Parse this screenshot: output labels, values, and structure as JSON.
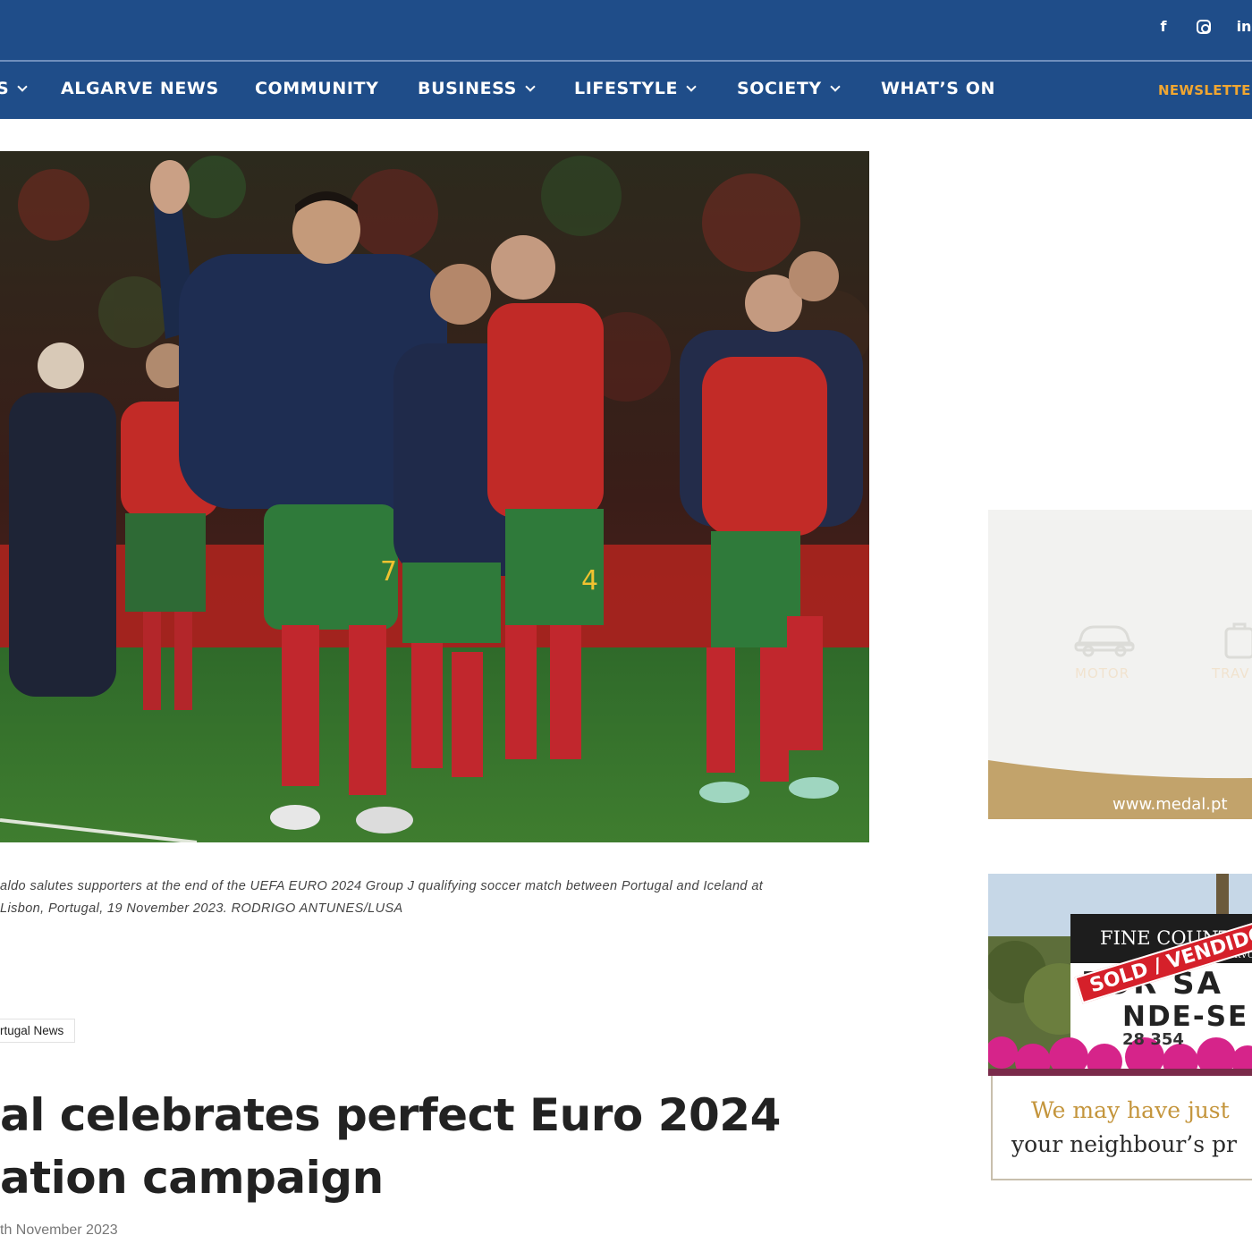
{
  "header": {
    "social": [
      {
        "icon": "facebook-icon",
        "glyph": "f"
      },
      {
        "icon": "instagram-icon",
        "glyph": ""
      },
      {
        "icon": "linkedin-icon",
        "glyph": "in"
      }
    ]
  },
  "nav": {
    "items": [
      {
        "label": "S",
        "has_dropdown": true
      },
      {
        "label": "ALGARVE NEWS",
        "has_dropdown": false
      },
      {
        "label": "COMMUNITY",
        "has_dropdown": false
      },
      {
        "label": "BUSINESS",
        "has_dropdown": true
      },
      {
        "label": "LIFESTYLE",
        "has_dropdown": true
      },
      {
        "label": "SOCIETY",
        "has_dropdown": true
      },
      {
        "label": "WHAT’S ON",
        "has_dropdown": false
      }
    ],
    "newsletter": "NEWSLETTEF"
  },
  "article": {
    "caption_line1": "aldo salutes supporters at the end of the UEFA EURO 2024 Group J qualifying soccer match between Portugal and Iceland at",
    "caption_line2": " Lisbon, Portugal, 19 November 2023. RODRIGO ANTUNES/LUSA",
    "category": "rtugal News",
    "headline_line1": "al celebrates perfect Euro 2024",
    "headline_line2": "ation campaign",
    "date": "th November 2023"
  },
  "ads": {
    "medal": {
      "label_motor": "MOTOR",
      "label_travel": "TRAV",
      "url": "www.medal.pt",
      "band_color": "#c2a36b"
    },
    "fine_country": {
      "brand": "FINE COUNTRY",
      "location": "CARVOEIRO",
      "for_sale": "FOR SA",
      "sold": "SOLD / VENDIDO",
      "vende": "NDE-SE",
      "phone": "28 354",
      "tagline1": "We may have just",
      "tagline2": "your neighbour’s pr",
      "accent": "#c4953c"
    }
  },
  "colors": {
    "header_bg": "#1f4d89",
    "newsletter": "#f0a631"
  }
}
